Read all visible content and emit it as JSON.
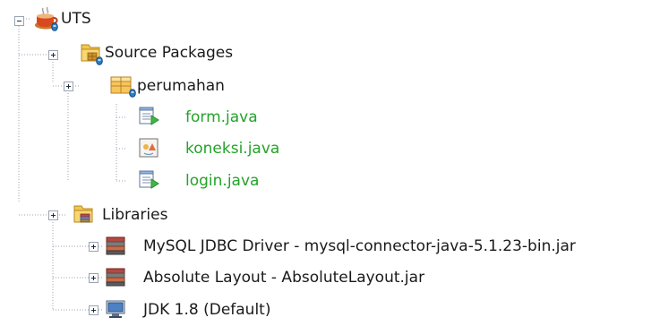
{
  "tree": {
    "project": {
      "label": "UTS",
      "expanded": true,
      "icon": "project-coffee-icon"
    },
    "source_packages": {
      "label": "Source Packages",
      "expanded": true,
      "icon": "source-packages-folder-icon"
    },
    "package": {
      "label": "perumahan",
      "expanded": true,
      "icon": "package-icon"
    },
    "files": [
      {
        "label": "form.java",
        "icon": "jframe-form-icon"
      },
      {
        "label": "koneksi.java",
        "icon": "java-class-icon"
      },
      {
        "label": "login.java",
        "icon": "jframe-form-icon"
      }
    ],
    "libraries": {
      "label": "Libraries",
      "expanded": true,
      "icon": "libraries-folder-icon"
    },
    "library_items": [
      {
        "label": "MySQL JDBC Driver - mysql-connector-java-5.1.23-bin.jar",
        "icon": "jar-library-icon"
      },
      {
        "label": "Absolute Layout - AbsoluteLayout.jar",
        "icon": "jar-library-icon"
      },
      {
        "label": "JDK 1.8 (Default)",
        "icon": "jdk-platform-icon"
      }
    ]
  },
  "colors": {
    "java_file_text": "#24a329",
    "default_text": "#1a1a1a",
    "guide_lines": "#9aa3b1"
  }
}
